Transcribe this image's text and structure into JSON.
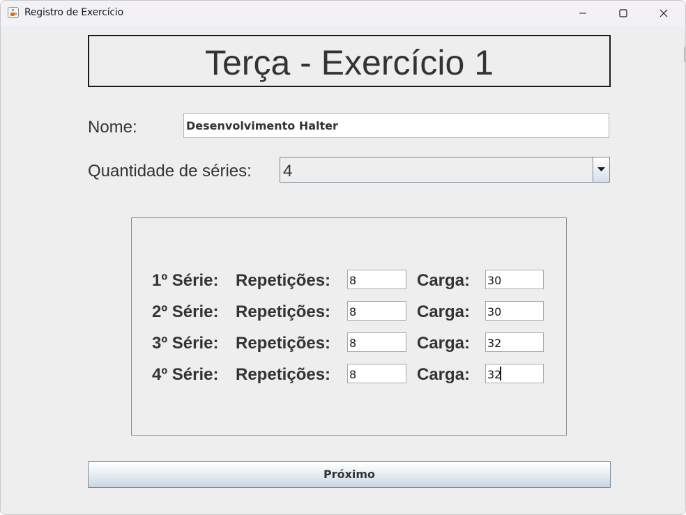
{
  "window": {
    "title": "Registro de Exercício"
  },
  "header": {
    "title": "Terça - Exercício 1"
  },
  "form": {
    "nome_label": "Nome:",
    "nome_value": "Desenvolvimento Halter",
    "quantidade_label": "Quantidade de séries:",
    "quantidade_value": "4"
  },
  "series": [
    {
      "label": "1º Série:",
      "reps_label": "Repetições:",
      "reps": "8",
      "carga_label": "Carga:",
      "carga": "30"
    },
    {
      "label": "2º Série:",
      "reps_label": "Repetições:",
      "reps": "8",
      "carga_label": "Carga:",
      "carga": "30"
    },
    {
      "label": "3º Série:",
      "reps_label": "Repetições:",
      "reps": "8",
      "carga_label": "Carga:",
      "carga": "32"
    },
    {
      "label": "4º Série:",
      "reps_label": "Repetições:",
      "reps": "8",
      "carga_label": "Carga:",
      "carga": "32"
    }
  ],
  "next_button": {
    "label": "Próximo"
  },
  "icons": {
    "app": "java-coffee-icon",
    "minimize": "minimize-icon",
    "maximize": "maximize-icon",
    "close": "close-icon",
    "dropdown": "chevron-down-icon"
  },
  "colors": {
    "window_bg": "#eeeeee",
    "titlebar_bg": "#f3f1f6",
    "text": "#333333",
    "button_gradient_end": "#c8d6e4"
  }
}
